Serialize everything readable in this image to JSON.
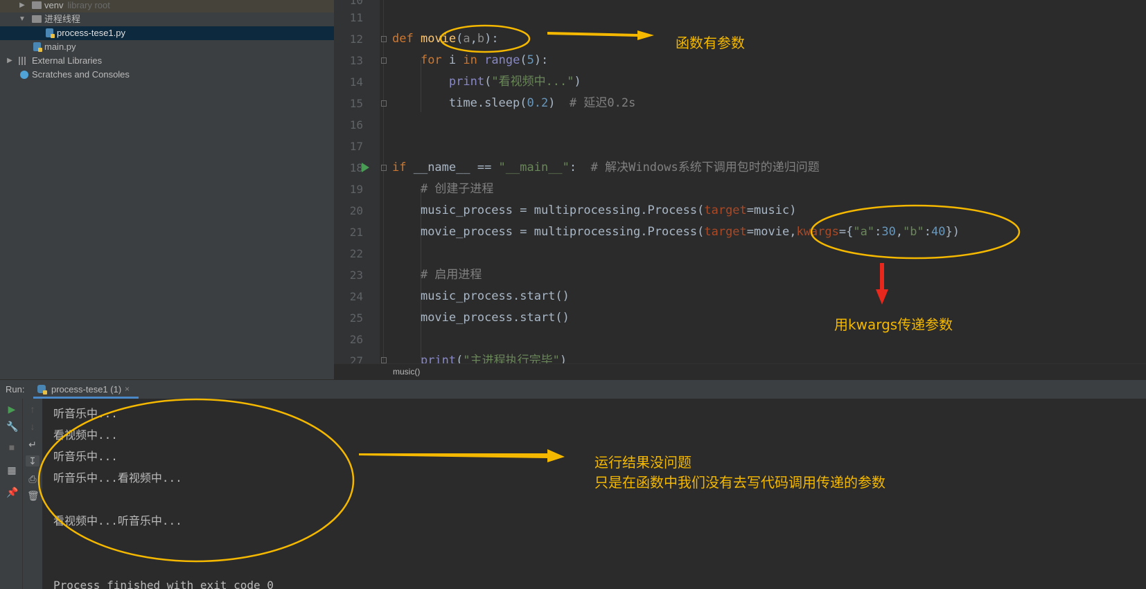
{
  "project_tree": [
    {
      "label": "venv",
      "sub": "library root",
      "expanded": false,
      "icon": "folder-icon"
    },
    {
      "label": "进程线程",
      "expanded": true,
      "icon": "folder-icon"
    },
    {
      "label": "process-tese1.py",
      "icon": "python-file-icon",
      "selected": true
    },
    {
      "label": "main.py",
      "icon": "python-file-icon"
    },
    {
      "label": "External Libraries",
      "expanded": false,
      "icon": "library-icon"
    },
    {
      "label": "Scratches and Consoles",
      "icon": "scratches-icon"
    }
  ],
  "editor": {
    "line_numbers": [
      "10",
      "11",
      "12",
      "13",
      "14",
      "15",
      "16",
      "17",
      "18",
      "19",
      "20",
      "21",
      "22",
      "23",
      "24",
      "25",
      "26",
      "27"
    ],
    "code": {
      "l12": {
        "kw": "def",
        "fn": "movie",
        "p1": "(",
        "a": "a",
        "comma": ",",
        "b": "b",
        "p2": "):"
      },
      "l13": {
        "kw_for": "for",
        "i": " i ",
        "kw_in": "in",
        "sp": " ",
        "range": "range",
        "p1": "(",
        "n": "5",
        "p2": "):"
      },
      "l14": {
        "print": "print",
        "p1": "(",
        "s": "\"看视频中...\"",
        "p2": ")"
      },
      "l15": {
        "t": "time.sleep(",
        "n": "0.2",
        "p2": ")  ",
        "c": "# 延迟0.2s"
      },
      "l18": {
        "kw": "if",
        "a": " __name__ == ",
        "s": "\"__main__\"",
        "b": ":  ",
        "c": "# 解决Windows系统下调用包时的递归问题"
      },
      "l19": {
        "c": "# 创建子进程"
      },
      "l20": {
        "a": "music_process = multiprocessing.Process(",
        "p": "target",
        "b": "=music)"
      },
      "l21": {
        "a": "movie_process = multiprocessing.Process(",
        "p": "target",
        "b": "=movie",
        "comma": ",",
        "p2": "kwargs",
        "c": "={",
        "s1": "\"a\"",
        "colon1": ":",
        "n1": "30",
        "comma2": ",",
        "s2": "\"b\"",
        "colon2": ":",
        "n2": "40",
        "d": "})"
      },
      "l23": {
        "c": "# 启用进程"
      },
      "l24": {
        "a": "music_process.start()"
      },
      "l25": {
        "a": "movie_process.start()"
      },
      "l27": {
        "print": "print",
        "p1": "(",
        "s": "\"主进程执行完毕\"",
        "p2": ")"
      }
    },
    "breadcrumb": "music()"
  },
  "run_panel": {
    "label": "Run:",
    "tab_label": "process-tese1 (1)",
    "tab_close": "×",
    "output": [
      "听音乐中...",
      "看视频中...",
      "听音乐中...",
      "听音乐中...看视频中...",
      "",
      "看视频中...听音乐中...",
      "",
      "",
      "Process finished with exit code 0"
    ]
  },
  "annotations": {
    "note1": "函数有参数",
    "note2": "用kwargs传递参数",
    "note3_line1": "运行结果没问题",
    "note3_line2": "只是在函数中我们没有去写代码调用传递的参数",
    "color": "#f5b800",
    "arrow_red": "#e8281c"
  },
  "icons": {
    "run": "run-icon",
    "wrench": "wrench-icon",
    "stop": "stop-icon",
    "layout": "layout-icon",
    "pin": "pin-icon",
    "up": "arrow-up-icon",
    "down": "arrow-down-icon",
    "soft_wrap": "soft-wrap-icon",
    "scroll_end": "scroll-to-end-icon",
    "print": "print-icon",
    "trash": "trash-icon"
  }
}
